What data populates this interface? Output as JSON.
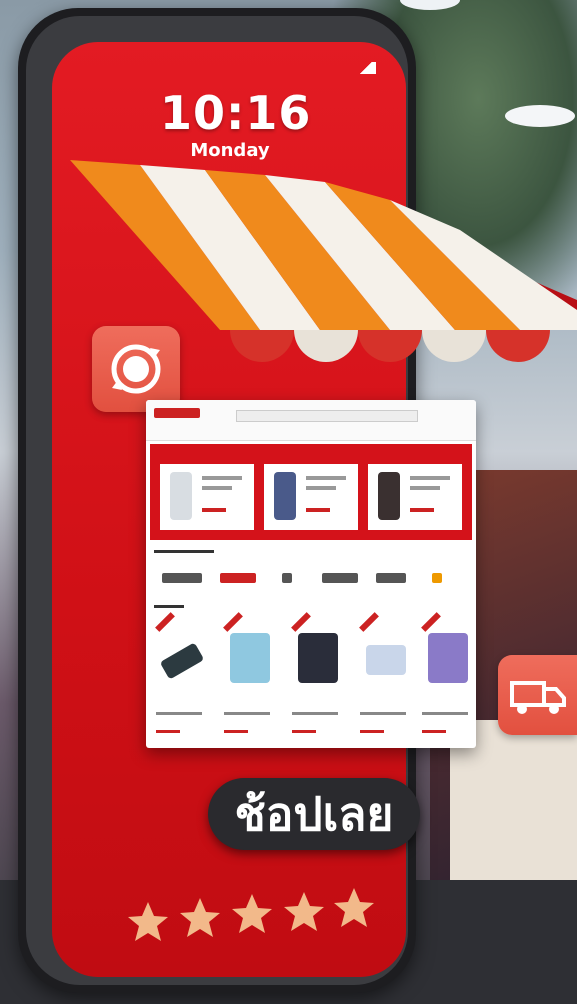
{
  "clock": {
    "time": "10:16",
    "day": "Monday"
  },
  "shop_button": {
    "label": "ช้อปเลย"
  },
  "rating": {
    "stars": 5,
    "max": 5
  },
  "icons": {
    "badge": "24-hour-icon",
    "delivery": "delivery-truck-icon",
    "store": "shop-awning-icon"
  },
  "colors": {
    "brand_red": "#e31b23",
    "awning_orange": "#f08a1c",
    "awning_white": "#f5f1ea",
    "icon_tile": "#e8604f",
    "star": "#f2b98a"
  }
}
